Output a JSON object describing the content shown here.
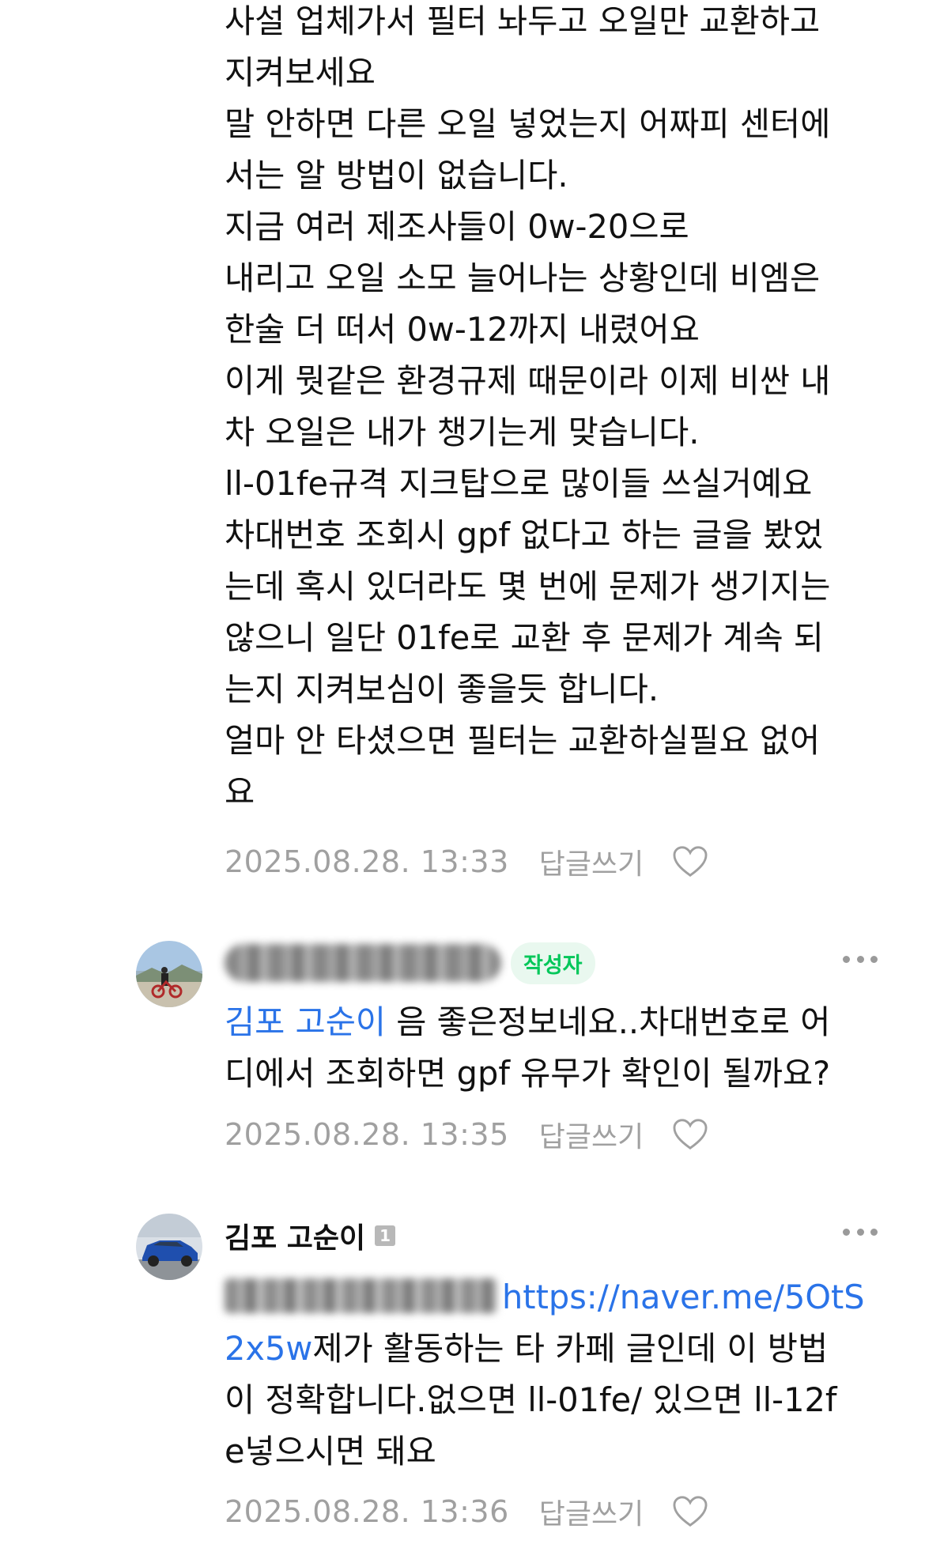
{
  "comments": [
    {
      "body_lines": [
        "사설 업체가서 필터 놔두고 오일만 교환하고",
        "지켜보세요",
        "말 안하면 다른 오일 넣었는지 어짜피 센터에",
        "서는 알 방법이 없습니다.",
        "지금 여러 제조사들이 0w-20으로",
        "내리고 오일 소모 늘어나는 상황인데 비엠은",
        "한술 더 떠서 0w-12까지 내렸어요",
        "이게 뭣같은 환경규제 때문이라 이제 비싼 내",
        "차 오일은 내가 챙기는게 맞습니다.",
        "ll-01fe규격 지크탑으로 많이들 쓰실거예요",
        "차대번호 조회시 gpf 없다고 하는 글을 봤었",
        "는데 혹시 있더라도 몇 번에 문제가 생기지는",
        "않으니 일단 01fe로 교환 후 문제가 계속 되",
        "는지 지켜보심이 좋을듯 합니다.",
        "얼마 안 타셨으면 필터는 교환하실필요 없어",
        "요"
      ],
      "timestamp": "2025.08.28. 13:33",
      "reply_label": "답글쓰기"
    },
    {
      "author_badge": "작성자",
      "mention": "김포 고순이",
      "body_first_rest": " 음 좋은정보네요..차대번호로 어",
      "body_second": "디에서 조회하면 gpf 유무가 확인이 될까요?",
      "timestamp": "2025.08.28. 13:35",
      "reply_label": "답글쓰기"
    },
    {
      "author": "김포 고순이",
      "level_badge": "1",
      "link_part1": "https://naver.me/5OtS",
      "link_part2": "2x5w",
      "body_after_link": "제가 활동하는 타 카페 글인데 이 방법",
      "body_line3": "이 정확합니다.없으면 ll-01fe/ 있으면 ll-12f",
      "body_line4": "e넣으시면 돼요",
      "timestamp": "2025.08.28. 13:36",
      "reply_label": "답글쓰기"
    }
  ],
  "colors": {
    "mention": "#2a73e8",
    "writer_badge": "#03c75a",
    "meta": "#a0a0a0"
  },
  "icons": [
    "more-icon",
    "heart-icon",
    "avatar"
  ]
}
